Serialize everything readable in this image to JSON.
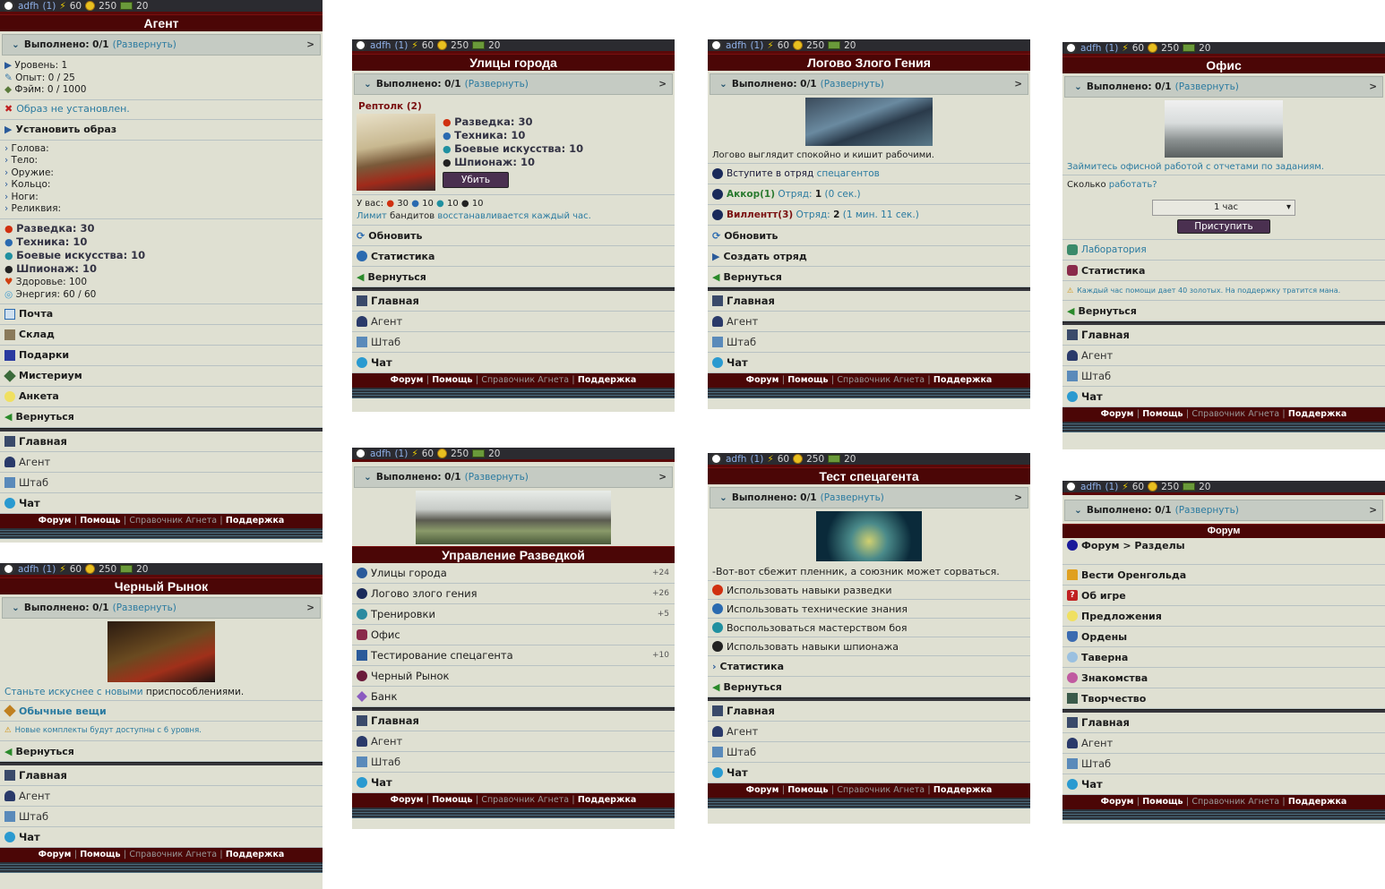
{
  "common": {
    "user": "adfh",
    "count": "(1)",
    "energy": "60",
    "gold": "250",
    "cash": "20",
    "quest_label": "Выполнено: 0/1",
    "quest_expand": "(Развернуть)",
    "quest_arrow": ">",
    "back": "Вернуться",
    "nav": {
      "main": "Главная",
      "agent": "Агент",
      "hq": "Штаб",
      "chat": "Чат"
    },
    "footer": {
      "forum": "Форум",
      "help": "Помощь",
      "guide": "Справочник Агнета",
      "support": "Поддержка",
      "sep": "|"
    }
  },
  "agent": {
    "title": "Агент",
    "level": "Уровень: 1",
    "exp": "Опыт: 0 / 25",
    "fame": "Фэйм: 0 / 1000",
    "no_image": "Образ не установлен.",
    "set_image": "Установить образ",
    "slots": [
      "Голова:",
      "Тело:",
      "Оружие:",
      "Кольцо:",
      "Ноги:",
      "Реликвия:"
    ],
    "stats": [
      "Разведка: 30",
      "Техника: 10",
      "Боевые искусства: 10",
      "Шпионаж: 10",
      "Здоровье: 100",
      "Энергия: 60 / 60"
    ],
    "menu": [
      "Почта",
      "Склад",
      "Подарки",
      "Мистериум",
      "Анкета"
    ]
  },
  "market": {
    "title": "Черный Рынок",
    "desc_a": "Станьте искуснее с новыми",
    "desc_b": "приспособлениями.",
    "items": "Обычные вещи",
    "note": "Новые комплекты будут доступны с 6 уровня."
  },
  "streets": {
    "title": "Улицы города",
    "enemy": "Рептолк (2)",
    "stats": [
      "Разведка: 30",
      "Техника: 10",
      "Боевые искусства: 10",
      "Шпионаж: 10"
    ],
    "kill": "Убить",
    "you_have": "У вас:",
    "my_vals": [
      "30",
      "10",
      "10",
      "10"
    ],
    "limit_a": "Лимит",
    "limit_b": "бандитов",
    "limit_c": "восстанавливается каждый час.",
    "refresh": "Обновить",
    "statistics": "Статистика"
  },
  "intel": {
    "title": "Управление Разведкой",
    "items": [
      {
        "label": "Улицы города",
        "bonus": "+24"
      },
      {
        "label": "Логово злого гения",
        "bonus": "+26"
      },
      {
        "label": "Тренировки",
        "bonus": "+5"
      },
      {
        "label": "Офис",
        "bonus": ""
      },
      {
        "label": "Тестирование спецагента",
        "bonus": "+10"
      },
      {
        "label": "Черный Рынок",
        "bonus": ""
      },
      {
        "label": "Банк",
        "bonus": ""
      }
    ]
  },
  "lair": {
    "title": "Логово Злого Гения",
    "desc": "Логово выглядит спокойно и кишит рабочими.",
    "join_a": "Вступите в отряд",
    "join_b": "спецагентов",
    "akkor": "Аккор(1)",
    "akkor_squad": "Отряд:",
    "akkor_n": "1",
    "akkor_t": "(0 сек.)",
    "villent": "Виллентт(3)",
    "villent_squad": "Отряд:",
    "villent_n": "2",
    "villent_t": "(1 мин. 11 сек.)",
    "refresh": "Обновить",
    "create": "Создать отряд"
  },
  "test": {
    "title": "Тест спецагента",
    "desc": "-Вот-вот сбежит пленник, а союзник может сорваться.",
    "opts": [
      "Использовать навыки разведки",
      "Использовать технические знания",
      "Воспользоваться мастерством боя",
      "Использовать навыки шпионажа"
    ],
    "statistics": "Статистика"
  },
  "office": {
    "title": "Офис",
    "desc": "Займитесь офисной работой с отчетами по заданиям.",
    "how_a": "Сколько",
    "how_b": "работать?",
    "select": "1 час",
    "start": "Приступить",
    "lab": "Лаборатория",
    "statistics": "Статистика",
    "note": "Каждый час помощи дает 40 золотых. На поддержку тратится мана."
  },
  "forum": {
    "title": "Форум",
    "crumb": "Форум > Разделы",
    "items": [
      "Вести Оренгольда",
      "Об игре",
      "Предложения",
      "Ордены",
      "Таверна",
      "Знакомства",
      "Творчество"
    ]
  }
}
